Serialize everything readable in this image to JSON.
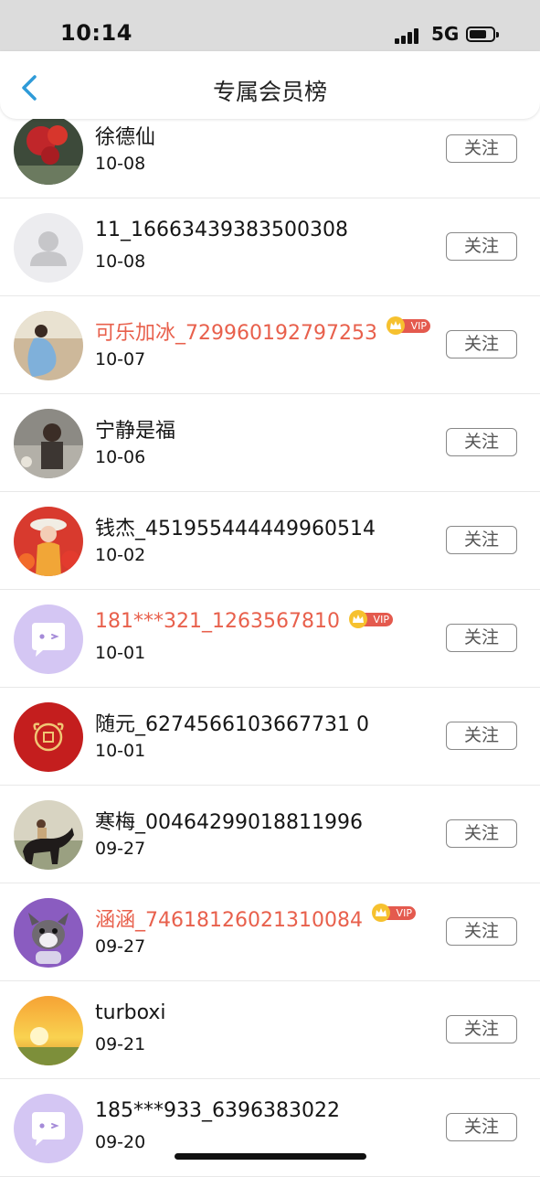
{
  "status_bar": {
    "time": "10:14",
    "network": "5G"
  },
  "nav": {
    "title": "专属会员榜"
  },
  "vip_tag": "VIP",
  "members": [
    {
      "name": "徐德仙",
      "date": "10-08",
      "vip": false,
      "avatar": "flower-photo",
      "follow_label": "关注"
    },
    {
      "name": "11_16663439383500308",
      "date": "10-08",
      "vip": false,
      "avatar": "default-user",
      "follow_label": "关注"
    },
    {
      "name": "可乐加冰_729960192797253",
      "date": "10-07",
      "vip": true,
      "avatar": "woman-blue-dress-photo",
      "follow_label": "关注"
    },
    {
      "name": "宁静是福",
      "date": "10-06",
      "vip": false,
      "avatar": "child-photo",
      "follow_label": "关注"
    },
    {
      "name": "钱杰_451955444449960514",
      "date": "10-02",
      "vip": false,
      "avatar": "woman-red-flowers-photo",
      "follow_label": "关注"
    },
    {
      "name": "181***321_1263567810",
      "date": "10-01",
      "vip": true,
      "avatar": "chat-bubble-default",
      "follow_label": "关注"
    },
    {
      "name": "随元_6274566103667731 0",
      "date": "10-01",
      "vip": false,
      "avatar": "red-fu-seal",
      "follow_label": "关注"
    },
    {
      "name": "寒梅_00464299018811996",
      "date": "09-27",
      "vip": false,
      "avatar": "horse-rider-photo",
      "follow_label": "关注"
    },
    {
      "name": "涵涵_74618126021310084",
      "date": "09-27",
      "vip": true,
      "avatar": "plush-toy-photo",
      "follow_label": "关注"
    },
    {
      "name": "turboxi",
      "date": "09-21",
      "vip": false,
      "avatar": "sunset-photo",
      "follow_label": "关注"
    },
    {
      "name": "185***933_6396383022",
      "date": "09-20",
      "vip": false,
      "avatar": "chat-bubble-default",
      "follow_label": "关注"
    }
  ],
  "colors": {
    "vip_name": "#e8604c",
    "status_bar_bg": "#dcdcdc",
    "back_arrow": "#2f9bd8"
  }
}
